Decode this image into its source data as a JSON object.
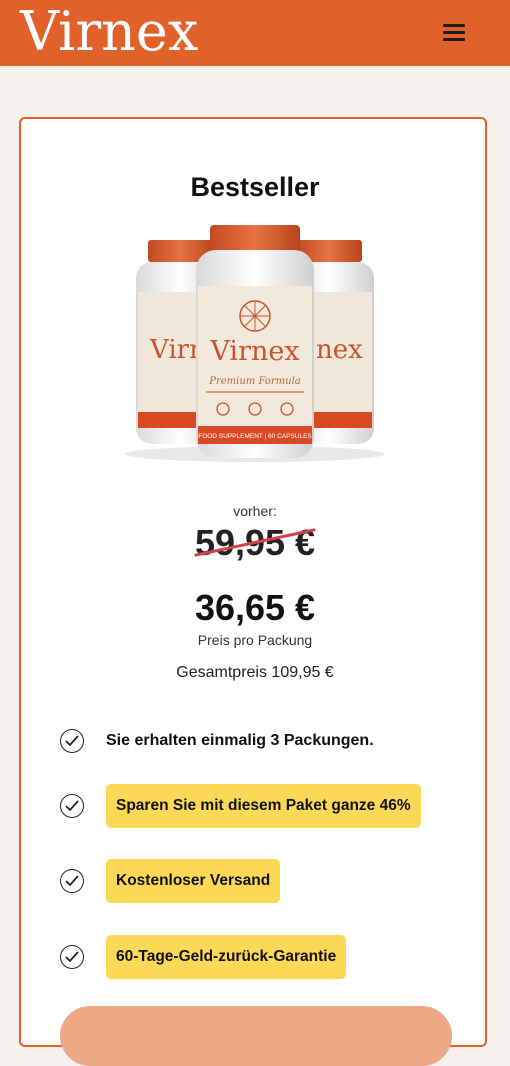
{
  "header": {
    "logo": "Virnex",
    "menu_icon": "hamburger-menu-icon",
    "brand_color": "#e0612a"
  },
  "offer": {
    "title": "Bestseller",
    "product_label": {
      "brand": "Virnex",
      "subtitle": "Premium Formula",
      "band": "FOOD SUPPLEMENT | 60 CAPSULES"
    },
    "before_label": "vorher:",
    "old_price": "59,95 €",
    "new_price": "36,65 €",
    "per_pack": "Preis pro Packung",
    "total": "Gesamtpreis 109,95 €",
    "features": [
      "Sie erhalten einmalig 3 Packungen.",
      "Sparen Sie mit diesem Paket ganze 46%",
      "Kostenloser Versand",
      "60-Tage-Geld-zurück-Garantie"
    ],
    "highlight_color": "#fbd856"
  }
}
